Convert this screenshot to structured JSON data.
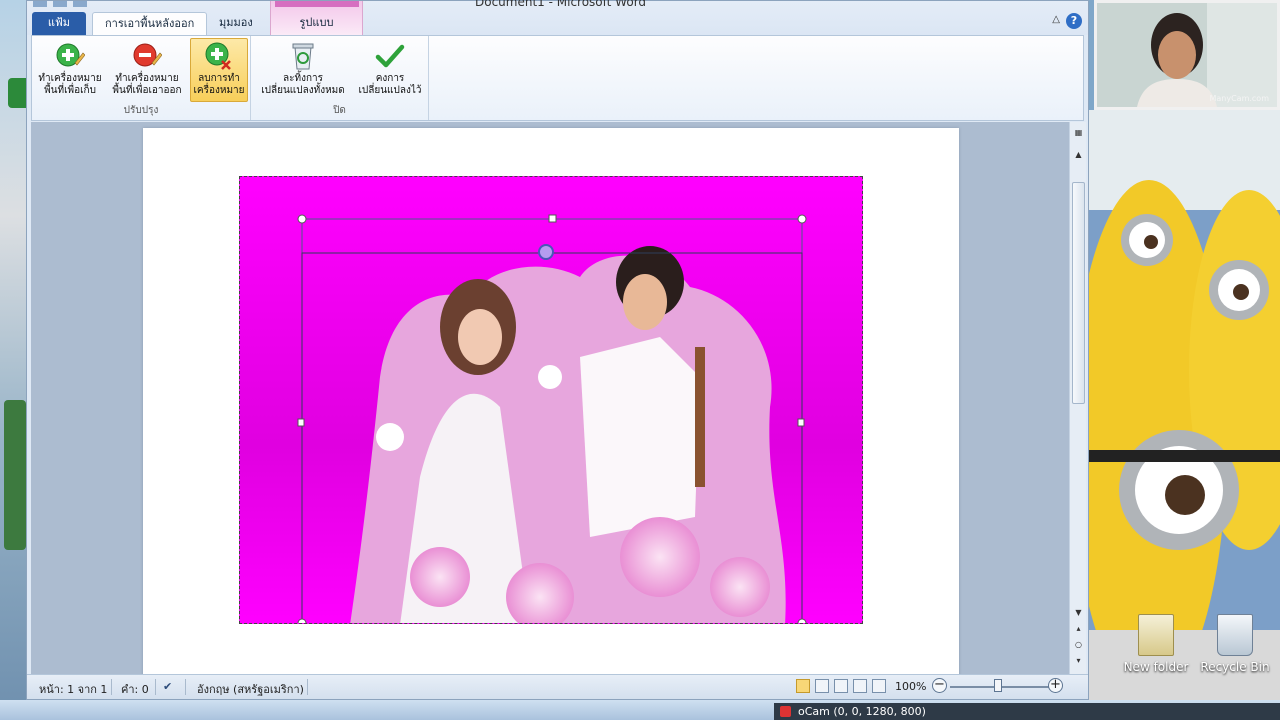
{
  "window": {
    "title_fragment": "Document1 - Microsoft Word"
  },
  "tabs": {
    "file": "แฟ้ม",
    "remove_background": "การเอาพื้นหลังออก",
    "view": "มุมมอง",
    "picture_format": "รูปแบบ"
  },
  "ribbon": {
    "refine_group": {
      "label": "ปรับปรุง",
      "mark_keep_line1": "ทำเครื่องหมาย",
      "mark_keep_line2": "พื้นที่เพื่อเก็บ",
      "mark_remove_line1": "ทำเครื่องหมาย",
      "mark_remove_line2": "พื้นที่เพื่อเอาออก",
      "delete_mark_line1": "ลบการทำ",
      "delete_mark_line2": "เครื่องหมาย"
    },
    "close_group": {
      "label": "ปิด",
      "discard_line1": "ละทิ้งการ",
      "discard_line2": "เปลี่ยนแปลงทั้งหมด",
      "keep_line1": "คงการ",
      "keep_line2": "เปลี่ยนแปลงไว้"
    }
  },
  "status_bar": {
    "page": "หน้า: 1 จาก 1",
    "words": "คำ: 0",
    "language": "อังกฤษ (สหรัฐอเมริกา)",
    "zoom": "100%",
    "zoom_level": 1.0
  },
  "webcam": {
    "watermark": "ManyCam.com"
  },
  "desktop": {
    "icons": [
      {
        "label": "New folder"
      },
      {
        "label": "Recycle Bin"
      }
    ]
  },
  "taskbar": {
    "ocam": "oCam (0, 0, 1280, 800)"
  },
  "colors": {
    "removal_overlay": "#ff00ff",
    "file_tab": "#2a5da8",
    "selected_button": "#f8cf5a"
  }
}
